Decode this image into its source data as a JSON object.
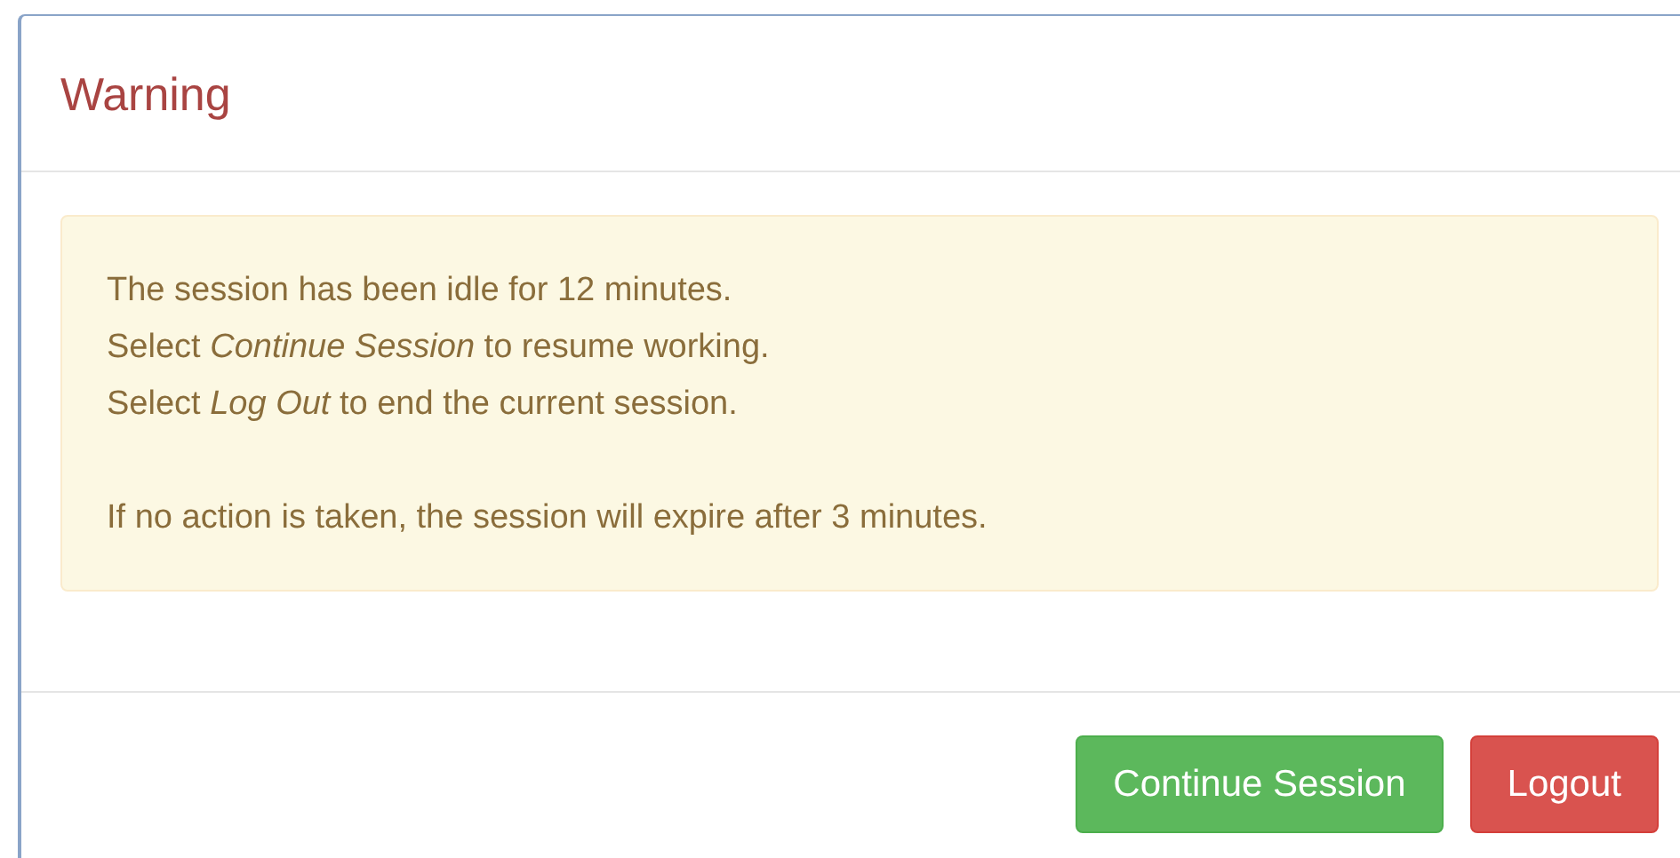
{
  "dialog": {
    "title": "Warning",
    "message": [
      [
        "The session has been idle for 12 minutes.",
        "Select *Continue Session* to resume working.",
        "Select *Log Out* to end the current session."
      ],
      [
        "If no action is taken, the session will expire after 3 minutes."
      ]
    ],
    "buttons": [
      {
        "label": "Continue Session",
        "kind": "success"
      },
      {
        "label": "Logout",
        "kind": "danger"
      }
    ]
  }
}
